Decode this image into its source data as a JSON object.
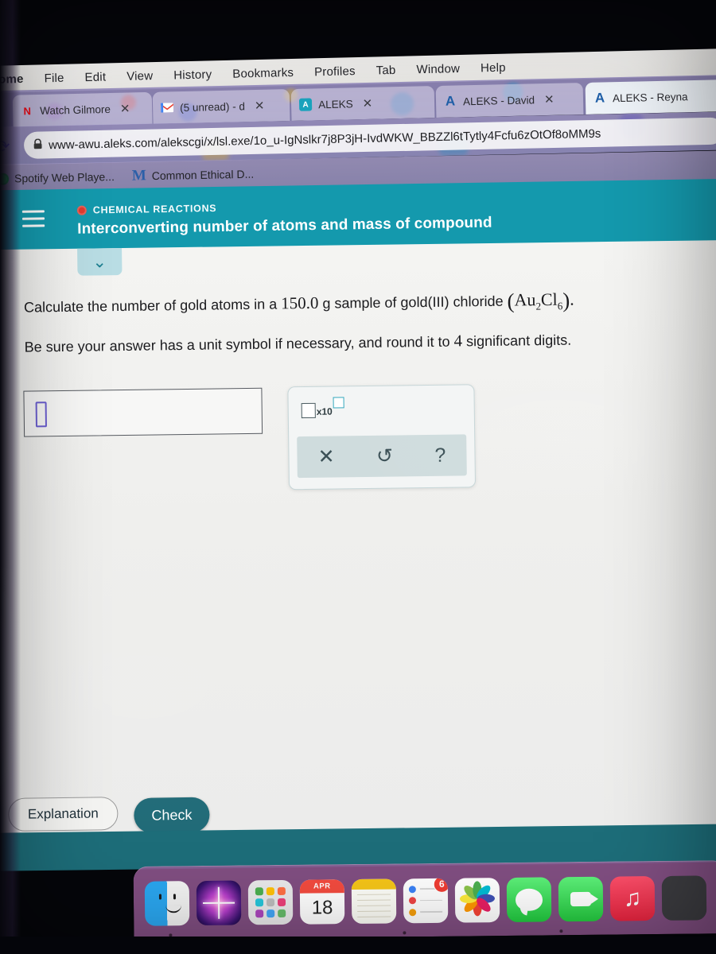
{
  "os_menubar": {
    "app_name": "rome",
    "items": [
      "File",
      "Edit",
      "View",
      "History",
      "Bookmarks",
      "Profiles",
      "Tab",
      "Window",
      "Help"
    ]
  },
  "browser": {
    "tabs": [
      {
        "favicon": "netflix-icon",
        "label": "Watch Gilmore",
        "close": "✕",
        "active": false
      },
      {
        "favicon": "gmail-icon",
        "label": "(5 unread) - d",
        "close": "✕",
        "active": false
      },
      {
        "favicon": "aleks-icon",
        "label": "ALEKS",
        "close": "✕",
        "active": false
      },
      {
        "favicon": "aleks-a-icon",
        "label": "ALEKS - David",
        "close": "✕",
        "active": false
      },
      {
        "favicon": "aleks-a-icon",
        "label": "ALEKS - Reyna",
        "close": "",
        "active": true
      }
    ],
    "reload_icon": "⟳",
    "lock_icon": "🔒",
    "url": "www-awu.aleks.com/alekscgi/x/lsl.exe/1o_u-IgNslkr7j8P3jH-IvdWKW_BBZZl6tTytly4Fcfu6zOtOf8oMM9s",
    "bookmarks": [
      {
        "icon": "spotify-icon",
        "label": "Spotify Web Playe..."
      },
      {
        "icon": "medium-icon",
        "label": "Common Ethical D..."
      }
    ]
  },
  "aleks_header": {
    "menu_icon": "hamburger-icon",
    "status_dot_color": "#e03b2f",
    "kicker": "CHEMICAL REACTIONS",
    "title": "Interconverting number of atoms and mass of compound",
    "collapse_icon": "⌄",
    "accent_color": "#1499ad"
  },
  "question": {
    "line1_part1": "Calculate the number of gold atoms in a ",
    "line1_amount": "150.0",
    "line1_part2": " g sample of gold(III) chloride ",
    "formula": {
      "open": "(",
      "e1": "Au",
      "s1": "2",
      "e2": "Cl",
      "s2": "6",
      "close": ")",
      "period": "."
    },
    "line2_part1": "Be sure your answer has a unit symbol if necessary, and round it to ",
    "line2_digits": "4",
    "line2_part2": " significant digits."
  },
  "answer": {
    "value": "",
    "caret_placeholder": "text-cursor",
    "caret_color": "#6b5fd0"
  },
  "palette": {
    "sci_notation": {
      "name": "scientific-notation-button",
      "mantissa_box": "□",
      "label": "x10",
      "exponent_box": "□"
    },
    "buttons": [
      {
        "name": "clear-button",
        "glyph": "✕"
      },
      {
        "name": "undo-button",
        "glyph": "↺"
      },
      {
        "name": "help-button",
        "glyph": "?"
      }
    ]
  },
  "actions": {
    "explanation_label": "Explanation",
    "check_label": "Check",
    "check_color": "#216b78"
  },
  "dock": {
    "apps": [
      {
        "name": "finder",
        "badge": ""
      },
      {
        "name": "siri",
        "badge": ""
      },
      {
        "name": "launchpad",
        "badge": ""
      },
      {
        "name": "calendar",
        "month": "APR",
        "day": "18",
        "badge": ""
      },
      {
        "name": "notes",
        "badge": ""
      },
      {
        "name": "reminders",
        "badge": "6"
      },
      {
        "name": "photos",
        "badge": ""
      },
      {
        "name": "messages",
        "badge": ""
      },
      {
        "name": "facetime",
        "badge": ""
      },
      {
        "name": "music",
        "badge": ""
      },
      {
        "name": "app",
        "badge": ""
      }
    ]
  }
}
